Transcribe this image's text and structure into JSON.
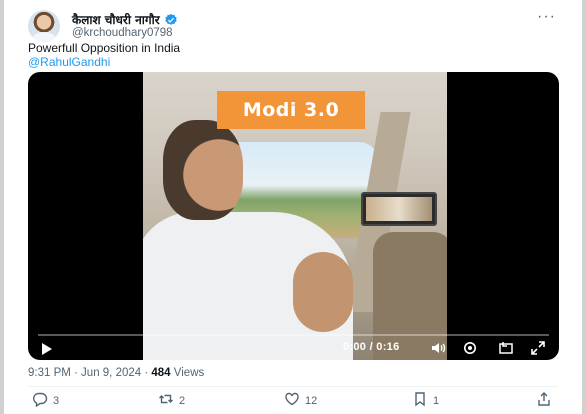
{
  "author": {
    "display_name": "कैलाश चौधरी नागौर",
    "handle": "@krchoudhary0798",
    "verified": true
  },
  "tweet": {
    "text": "Powerfull Opposition in India",
    "mention": "@RahulGandhi"
  },
  "video": {
    "overlay_text": "Modi 3.0",
    "time_display": "0:00 / 0:16",
    "progress": 0.0
  },
  "meta": {
    "timestamp": "9:31 PM · Jun 9, 2024",
    "separator": " · ",
    "views_count": "484",
    "views_label": "Views"
  },
  "actions": {
    "replies": "3",
    "reposts": "2",
    "likes": "12",
    "bookmarks": "1"
  },
  "icons": {
    "verified": "verified-badge-icon",
    "more": "more-options-icon",
    "play": "play-icon",
    "volume": "volume-icon",
    "settings": "settings-icon",
    "pip": "picture-in-picture-icon",
    "fullscreen": "fullscreen-icon",
    "reply": "reply-icon",
    "repost": "repost-icon",
    "like": "like-icon",
    "bookmark": "bookmark-icon",
    "share": "share-icon"
  },
  "colors": {
    "accent": "#1d9bf0",
    "overlay_badge": "#f29538",
    "muted_text": "#536471"
  }
}
